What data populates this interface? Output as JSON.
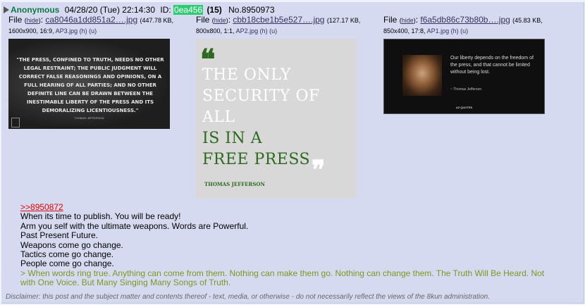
{
  "header": {
    "name": "Anonymous",
    "date": "04/28/20 (Tue) 22:14:30",
    "id_label": "ID:",
    "id_value": "0ea456",
    "replies": "(15)",
    "post_no": "No.8950973"
  },
  "files": [
    {
      "label": "File",
      "hide": "hide",
      "filename": "ca8046a1dd851a2….jpg",
      "size": "(447.78 KB,",
      "dims": "1600x900, 16:9,",
      "orig": "AP3.jpg",
      "h": "(h)",
      "u": "(u)",
      "image_text": "\"THE PRESS, CONFINED TO TRUTH, NEEDS NO OTHER LEGAL RESTRAINT; THE PUBLIC JUDGMENT WILL CORRECT FALSE REASONINGS AND OPINIONS, ON A FULL HEARING OF ALL PARTIES; AND NO OTHER DEFINITE LINE CAN BE DRAWN BETWEEN THE INESTIMABLE LIBERTY OF THE PRESS AND ITS DEMORALIZING LICENTIOUSNESS.\"",
      "image_attr": "THOMAS JEFFERSON"
    },
    {
      "label": "File",
      "hide": "hide",
      "filename": "cbb18cbe1b5e527….jpg",
      "size": "(127.17 KB,",
      "dims": "800x800, 1:1,",
      "orig": "AP2.jpg",
      "h": "(h)",
      "u": "(u)",
      "image_lines": [
        "THE ONLY",
        "SECURITY OF",
        "ALL",
        "IS IN A",
        "FREE PRESS"
      ],
      "image_attr": "THOMAS JEFFERSON"
    },
    {
      "label": "File",
      "hide": "hide",
      "filename": "f6a5db86c73b80b….jpg",
      "size": "(45.83 KB,",
      "dims": "850x400, 17:8,",
      "orig": "AP1.jpg",
      "h": "(h)",
      "u": "(u)",
      "image_text": "Our liberty depends on the freedom of the press, and that cannot be limited without being lost.",
      "image_attr": "~ Thomas Jefferson",
      "image_brand": "AZ QUOTES"
    }
  ],
  "body": {
    "quote_link": ">>8950872",
    "lines": [
      "When its time to publish. You will be ready!",
      "Arm you self with the ultimate weapons. Words are Powerful.",
      "Past Present Future.",
      "Weapons come go change.",
      "Tactics come go change.",
      "People come go change."
    ],
    "greentext": "> When words ring true. Anything can come from them. Nothing can make them go. Nothing can change them. The Truth Will Be Heard. Not with One Voice. But Many Singing Many Songs of Truth."
  },
  "disclaimer": "Disclaimer: this post and the subject matter and contents thereof - text, media, or otherwise - do not necessarily reflect the views of the 8kun administration.",
  "colors": {
    "post_bg": "#d6daf0",
    "name": "#117743",
    "id_highlight": "#2ecc71",
    "quote_link": "#d00000",
    "greentext": "#789922"
  }
}
